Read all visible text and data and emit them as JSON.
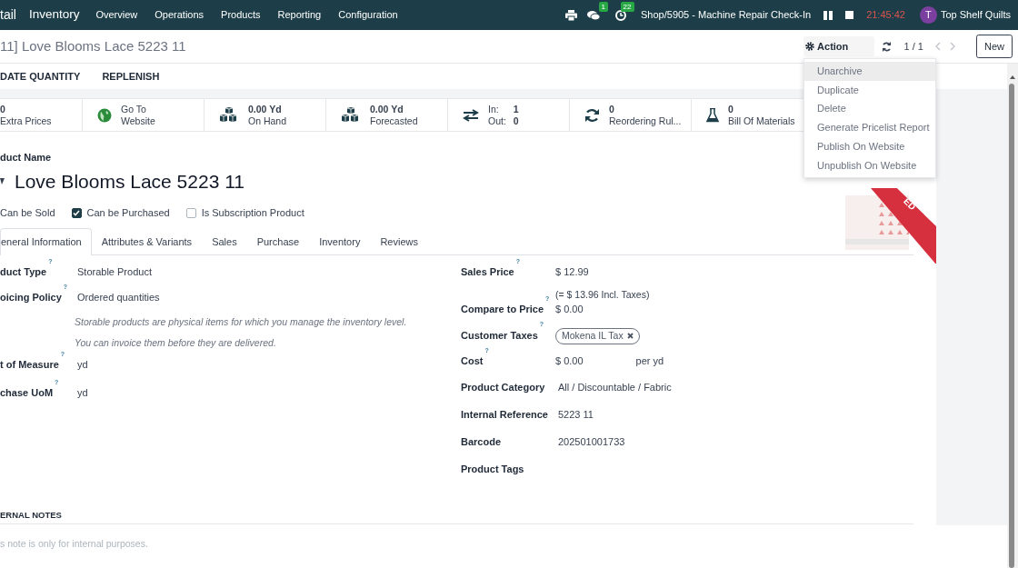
{
  "navbar": {
    "brand": "tail",
    "app": "Inventory",
    "menu": [
      "Overview",
      "Operations",
      "Products",
      "Reporting",
      "Configuration"
    ],
    "messages_badge": "1",
    "activities_badge": "22",
    "session": "Shop/5905 - Machine Repair Check-In",
    "timer": "21:45:42",
    "user": {
      "initial": "T",
      "name": "Top Shelf Quilts"
    }
  },
  "breadcrumb": "11] Love Blooms Lace 5223 11",
  "control": {
    "action": "Action",
    "pager": "1 / 1",
    "new_button": "New"
  },
  "action_menu": [
    {
      "label": "Unarchive",
      "selected": true
    },
    {
      "label": "Duplicate",
      "selected": false
    },
    {
      "label": "Delete",
      "selected": false
    },
    {
      "label": "Generate Pricelist Report",
      "selected": false
    },
    {
      "label": "Publish On Website",
      "selected": false
    },
    {
      "label": "Unpublish On Website",
      "selected": false
    }
  ],
  "header_buttons": [
    "DATE QUANTITY",
    "REPLENISH"
  ],
  "stat_buttons": [
    {
      "kind": "plain",
      "value": "0",
      "label": "Extra Prices"
    },
    {
      "kind": "globe",
      "value": "Go To",
      "label": "Website"
    },
    {
      "kind": "cubes",
      "value": "0.00 Yd",
      "label": "On Hand"
    },
    {
      "kind": "cubes",
      "value": "0.00 Yd",
      "label": "Forecasted"
    },
    {
      "kind": "inout",
      "in_label": "In:",
      "in_value": "1",
      "out_label": "Out:",
      "out_value": "0"
    },
    {
      "kind": "refresh",
      "value": "0",
      "label": "Reordering Rul..."
    },
    {
      "kind": "flask",
      "value": "0",
      "label": "Bill Of Materials"
    }
  ],
  "product": {
    "name_label": "duct Name",
    "name": "Love Blooms Lace 5223 11",
    "ribbon": "ED"
  },
  "options": [
    {
      "label": "Can be Sold"
    },
    {
      "label": "Can be Purchased",
      "checked": true
    },
    {
      "label": "Is Subscription Product",
      "checked": false
    }
  ],
  "tabs": [
    {
      "label": "eneral Information",
      "selected": true
    },
    {
      "label": "Attributes & Variants",
      "selected": false
    },
    {
      "label": "Sales",
      "selected": false
    },
    {
      "label": "Purchase",
      "selected": false
    },
    {
      "label": "Inventory",
      "selected": false
    },
    {
      "label": "Reviews",
      "selected": false
    }
  ],
  "left_fields": [
    {
      "kind": "field",
      "label": "duct Type",
      "help": "?",
      "value": "Storable Product"
    },
    {
      "kind": "field",
      "label": "oicing Policy",
      "help": "?",
      "value": "Ordered quantities"
    },
    {
      "kind": "note",
      "value": "Storable products are physical items for which you manage the inventory level."
    },
    {
      "kind": "note",
      "value": "You can invoice them before they are delivered."
    },
    {
      "kind": "field",
      "label": "t of Measure",
      "help": "?",
      "value": "yd"
    },
    {
      "kind": "field",
      "label": "chase UoM",
      "help": "?",
      "value": "yd"
    }
  ],
  "right_fields": [
    {
      "kind": "field",
      "label": "Sales Price",
      "help": "?",
      "value": "$ 12.99",
      "subtext": "(= $ 13.96 Incl. Taxes)"
    },
    {
      "kind": "field",
      "label": "Compare to Price",
      "help": "?",
      "value": "$ 0.00"
    },
    {
      "kind": "tag",
      "label": "Customer Taxes",
      "help": "?",
      "value": "Mokena IL Tax"
    },
    {
      "kind": "field",
      "label": "Cost",
      "help": "?",
      "value": "$ 0.00",
      "suffix": "per yd"
    },
    {
      "kind": "field",
      "label": "Product Category",
      "value": "All / Discountable / Fabric"
    },
    {
      "kind": "field",
      "label": "Internal Reference",
      "value": "5223 11"
    },
    {
      "kind": "field",
      "label": "Barcode",
      "value": "202501001733"
    },
    {
      "kind": "field",
      "label": "Product Tags"
    }
  ],
  "notes": {
    "title": "ERNAL NOTES",
    "placeholder": "s note is only for internal purposes."
  }
}
